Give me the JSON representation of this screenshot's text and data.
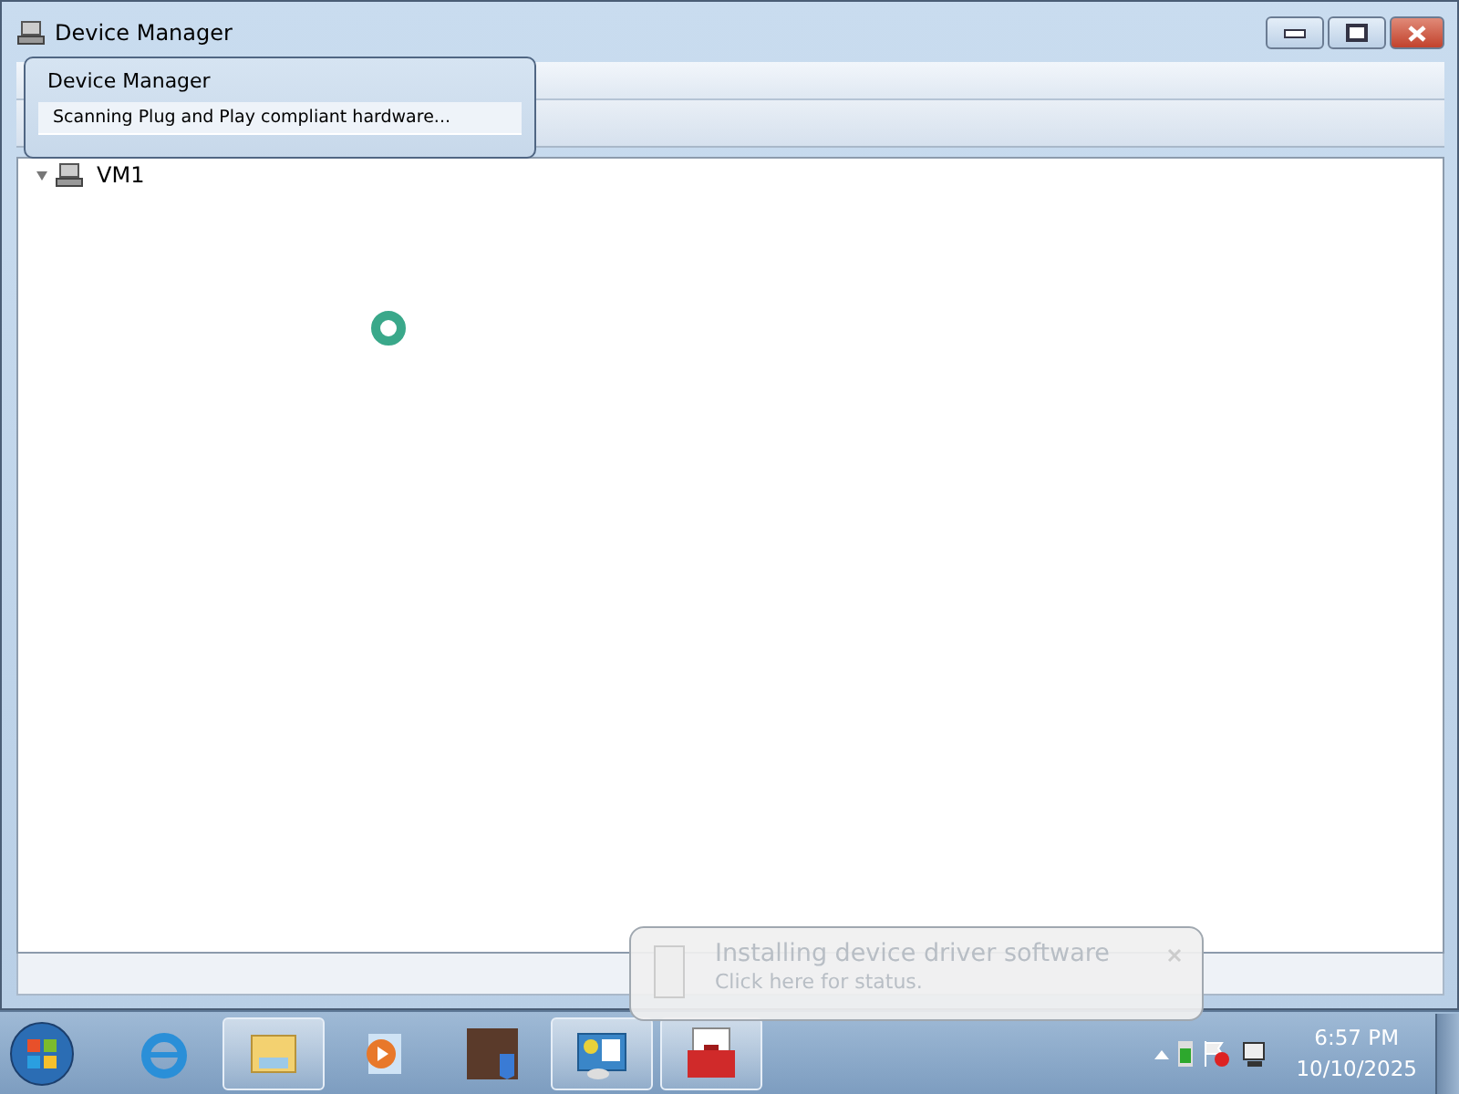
{
  "window": {
    "title": "Device Manager"
  },
  "progress_dialog": {
    "title": "Device Manager",
    "message": "Scanning Plug and Play compliant hardware..."
  },
  "tree": [
    {
      "label": "VM1",
      "expanded": true
    }
  ],
  "balloon": {
    "title": "Installing device driver software",
    "subtitle": "Click here for status."
  },
  "taskbar": {
    "buttons": [
      {
        "kind": "browser",
        "running": false
      },
      {
        "kind": "folder",
        "running": true
      },
      {
        "kind": "media",
        "running": false
      },
      {
        "kind": "photo",
        "running": false
      },
      {
        "kind": "panel",
        "running": true
      },
      {
        "kind": "toolbox",
        "running": true
      }
    ]
  },
  "clock": {
    "time": "6:57 PM",
    "date": "10/10/2025"
  }
}
